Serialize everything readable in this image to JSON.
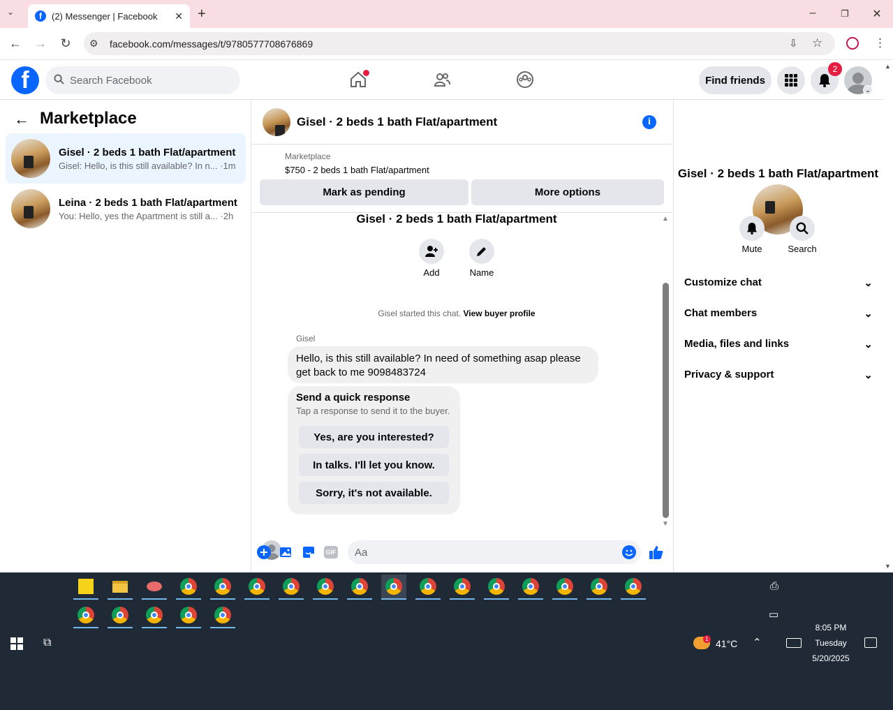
{
  "browser": {
    "tab_title": "(2) Messenger | Facebook",
    "url": "facebook.com/messages/t/9780577708676869"
  },
  "fb_header": {
    "search_placeholder": "Search Facebook",
    "find_friends": "Find friends",
    "notification_count": "2"
  },
  "left_panel": {
    "title": "Marketplace",
    "conversations": [
      {
        "name": "Gisel · 2 beds 1 bath Flat/apartment",
        "preview": "Gisel: Hello, is this still available? In n... ·1m",
        "active": true
      },
      {
        "name": "Leina · 2 beds 1 bath Flat/apartment",
        "preview": "You: Hello, yes the Apartment is still a... ·2h",
        "active": false
      }
    ]
  },
  "chat": {
    "header_title": "Gisel · 2 beds 1 bath Flat/apartment",
    "marketplace_label": "Marketplace",
    "listing": "$750 - 2 beds 1 bath Flat/apartment",
    "mark_pending": "Mark as pending",
    "more_options": "More options",
    "chat_name": "Gisel · 2 beds 1 bath Flat/apartment",
    "add_label": "Add",
    "name_label": "Name",
    "started_text": "Gisel started this chat.",
    "view_buyer": "View buyer profile",
    "sender": "Gisel",
    "message": "Hello, is this still available? In need of something asap please get back to me 9098483724",
    "quick_title": "Send a quick response",
    "quick_sub": "Tap a response to send it to the buyer.",
    "quick_responses": [
      "Yes, are you interested?",
      "In talks. I'll let you know.",
      "Sorry, it's not available."
    ],
    "input_placeholder": "Aa"
  },
  "right_panel": {
    "title": "Gisel · 2 beds 1 bath Flat/apartment",
    "mute": "Mute",
    "search": "Search",
    "sections": [
      "Customize chat",
      "Chat members",
      "Media, files and links",
      "Privacy & support"
    ]
  },
  "taskbar": {
    "weather": "41°C",
    "weather_badge": "1",
    "time": "8:05 PM",
    "day": "Tuesday",
    "date": "5/20/2025"
  },
  "colors": {
    "fb_blue": "#0866ff",
    "badge_red": "#e41e3f",
    "tab_bar": "#f8dde3",
    "taskbar": "#1f2a36"
  }
}
